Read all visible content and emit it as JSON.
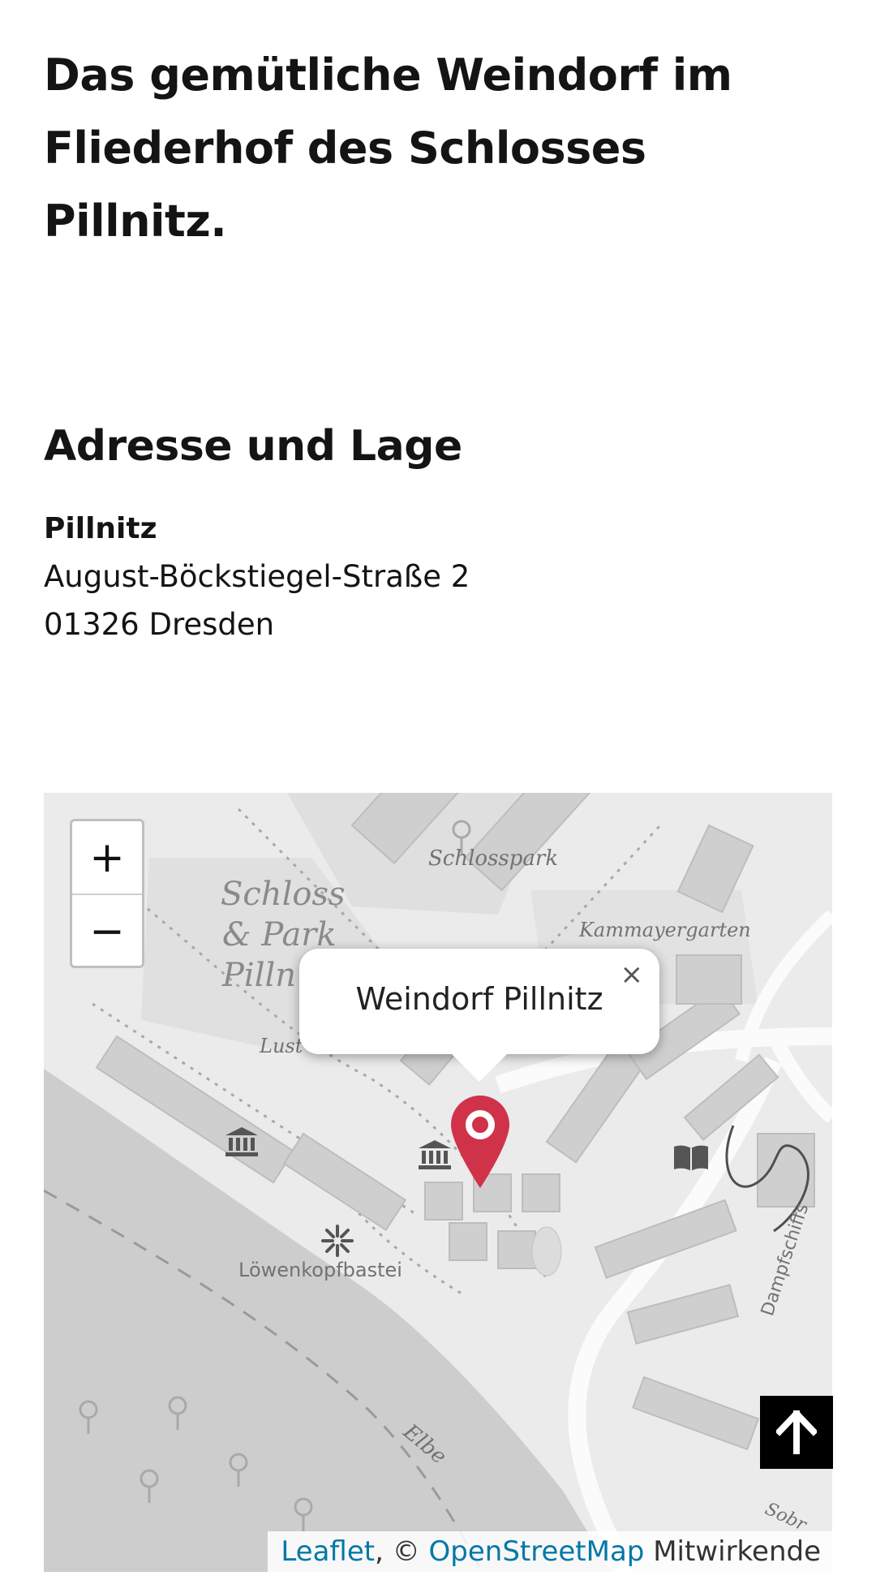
{
  "intro": {
    "line1": "Das gemütliche Weindorf im",
    "line2": "Fliederhof des Schlosses",
    "line3": "Pillnitz."
  },
  "address": {
    "title": "Adresse und Lage",
    "place": "Pillnitz",
    "street": "August-Böckstiegel-Straße 2",
    "city": "01326 Dresden"
  },
  "map": {
    "labels": {
      "schlosspark": "Schlosspark",
      "schloss1": "Schloss",
      "schloss2": "& Park",
      "schloss3": "Pilln",
      "kammayergarten": "Kammayergarten",
      "lust": "Lust",
      "loewenkopfbastei": "Löwenkopfbastei",
      "elbe": "Elbe",
      "dampfschiff": "Dampfschiffs",
      "sobr": "Sobr"
    },
    "zoom_in": "+",
    "zoom_out": "−",
    "popup": {
      "text": "Weindorf Pillnitz",
      "close": "×"
    },
    "attribution": {
      "leaflet": "Leaflet",
      "separator": ", © ",
      "osm": "OpenStreetMap",
      "suffix": " Mitwirkende"
    },
    "marker_color": "#d0324a",
    "icons": [
      "museum-icon",
      "museum-icon",
      "library-icon",
      "viewpoint-icon",
      "tree-icon"
    ]
  },
  "scroll_top": {
    "icon": "arrow-up-icon"
  }
}
